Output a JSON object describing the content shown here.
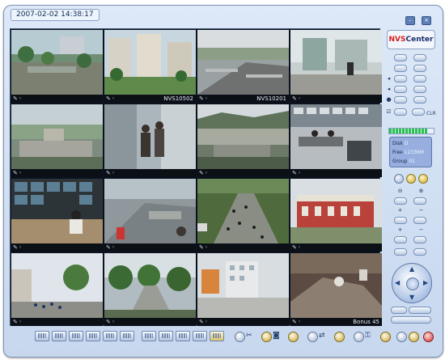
{
  "window": {
    "timestamp": "2007-02-02 14:38:17"
  },
  "brand": {
    "prefix": "NVS",
    "suffix": "Center"
  },
  "cameras": [
    {
      "label": "",
      "selected": true
    },
    {
      "label": "NVS10502"
    },
    {
      "label": "NVS10201"
    },
    {
      "label": ""
    },
    {
      "label": ""
    },
    {
      "label": ""
    },
    {
      "label": ""
    },
    {
      "label": ""
    },
    {
      "label": ""
    },
    {
      "label": ""
    },
    {
      "label": ""
    },
    {
      "label": ""
    },
    {
      "label": ""
    },
    {
      "label": ""
    },
    {
      "label": ""
    },
    {
      "label": "Bonus 45"
    }
  ],
  "status": {
    "disk_label": "Disk",
    "disk_value": "D",
    "free_label": "Free",
    "free_value": "12336M",
    "group_label": "Group",
    "group_value": "01",
    "level_percent": 85
  },
  "panel": {
    "clear_label": "CLR"
  },
  "colors": {
    "accent": "#2fd0ff",
    "brand_red": "#d81d1d",
    "frame": "#c7d7ee"
  },
  "icons": [
    "pointer-icon",
    "speaker-icon",
    "record-icon",
    "ptz-dial-icon",
    "snapshot-icon",
    "exit-icon"
  ]
}
